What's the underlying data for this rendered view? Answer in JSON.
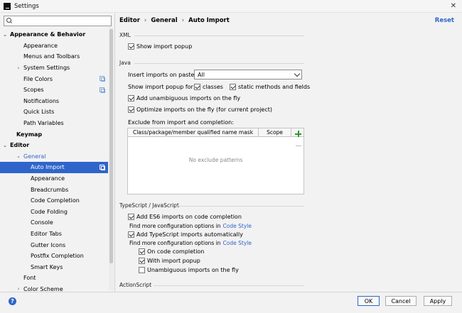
{
  "window": {
    "title": "Settings",
    "close_glyph": "✕"
  },
  "search": {
    "value": "",
    "placeholder": ""
  },
  "tree": [
    {
      "label": "Appearance & Behavior",
      "indent": 1,
      "arrow": "expanded",
      "bold": true
    },
    {
      "label": "Appearance",
      "indent": 3
    },
    {
      "label": "Menus and Toolbars",
      "indent": 3
    },
    {
      "label": "System Settings",
      "indent": 3,
      "arrow": "collapsed"
    },
    {
      "label": "File Colors",
      "indent": 3,
      "copy": true
    },
    {
      "label": "Scopes",
      "indent": 3,
      "copy": true
    },
    {
      "label": "Notifications",
      "indent": 3
    },
    {
      "label": "Quick Lists",
      "indent": 3
    },
    {
      "label": "Path Variables",
      "indent": 3
    },
    {
      "label": "Keymap",
      "indent": 2,
      "bold": true
    },
    {
      "label": "Editor",
      "indent": 1,
      "arrow": "expanded",
      "bold": true
    },
    {
      "label": "General",
      "indent": 3,
      "arrow": "expanded",
      "subselected": true
    },
    {
      "label": "Auto Import",
      "indent": 4,
      "selected": true,
      "copy": true
    },
    {
      "label": "Appearance",
      "indent": 4
    },
    {
      "label": "Breadcrumbs",
      "indent": 4
    },
    {
      "label": "Code Completion",
      "indent": 4
    },
    {
      "label": "Code Folding",
      "indent": 4
    },
    {
      "label": "Console",
      "indent": 4
    },
    {
      "label": "Editor Tabs",
      "indent": 4
    },
    {
      "label": "Gutter Icons",
      "indent": 4
    },
    {
      "label": "Postfix Completion",
      "indent": 4
    },
    {
      "label": "Smart Keys",
      "indent": 4
    },
    {
      "label": "Font",
      "indent": 3
    },
    {
      "label": "Color Scheme",
      "indent": 3,
      "arrow": "collapsed"
    }
  ],
  "breadcrumb": [
    "Editor",
    "General",
    "Auto Import"
  ],
  "breadcrumb_sep": "›",
  "reset_label": "Reset",
  "xml": {
    "label": "XML",
    "show_import_popup": {
      "label": "Show import popup",
      "checked": true
    }
  },
  "java": {
    "label": "Java",
    "insert_label": "Insert imports on paste:",
    "insert_value": "All",
    "popup_label": "Show import popup for:",
    "classes": {
      "label": "classes",
      "checked": true
    },
    "static_methods": {
      "label": "static methods and fields",
      "checked": true
    },
    "add_unambiguous": {
      "label": "Add unambiguous imports on the fly",
      "checked": true
    },
    "optimize": {
      "label": "Optimize imports on the fly (for current project)",
      "checked": true
    },
    "exclude_label": "Exclude from import and completion:",
    "col_mask": "Class/package/member qualified name mask",
    "col_scope": "Scope",
    "empty_text": "No exclude patterns"
  },
  "ts": {
    "label": "TypeScript / JavaScript",
    "es6": {
      "label": "Add ES6 imports on code completion",
      "checked": true
    },
    "more1": "Find more configuration options in",
    "more_link": "Code Style",
    "ts_auto": {
      "label": "Add TypeScript imports automatically",
      "checked": true
    },
    "more2": "Find more configuration options in",
    "on_completion": {
      "label": "On code completion",
      "checked": true
    },
    "with_popup": {
      "label": "With import popup",
      "checked": true
    },
    "unambiguous": {
      "label": "Unambiguous imports on the fly",
      "checked": false
    }
  },
  "actionscript": {
    "label": "ActionScript"
  },
  "buttons": {
    "help": "?",
    "ok": "OK",
    "cancel": "Cancel",
    "apply": "Apply"
  },
  "colors": {
    "accent": "#2f65ca",
    "plus": "#2b9b2b"
  }
}
